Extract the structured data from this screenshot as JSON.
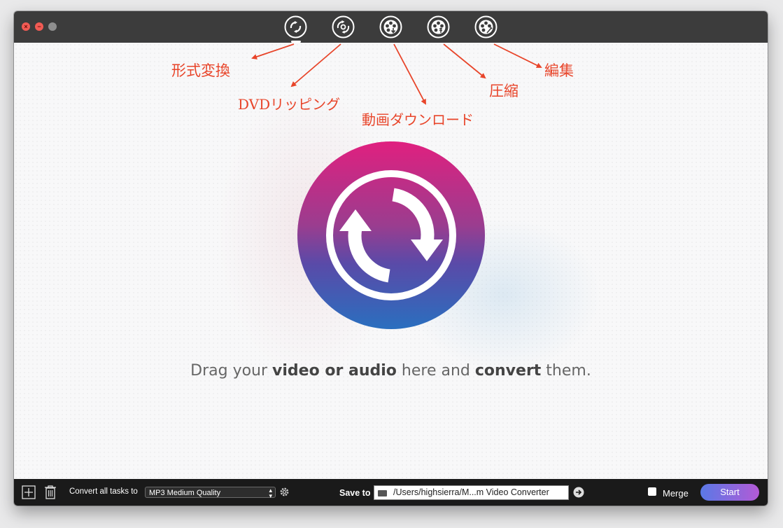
{
  "toolbar": {
    "items": [
      {
        "name": "convert",
        "annotation": "形式変換"
      },
      {
        "name": "dvd-ripping",
        "annotation": "DVDリッピング"
      },
      {
        "name": "video-download",
        "annotation": "動画ダウンロード"
      },
      {
        "name": "compress",
        "annotation": "圧縮"
      },
      {
        "name": "edit",
        "annotation": "編集"
      }
    ]
  },
  "main": {
    "drag_prefix": "Drag your ",
    "drag_bold1": "video or audio",
    "drag_middle": " here and ",
    "drag_bold2": "convert",
    "drag_suffix": " them."
  },
  "bottom": {
    "convert_label": "Convert all tasks to",
    "format_value": "MP3 Medium Quality",
    "save_label": "Save to",
    "save_path": "/Users/highsierra/M...m Video Converter",
    "merge_label": "Merge",
    "start_label": "Start"
  },
  "colors": {
    "annotation": "#e8452a",
    "titlebar": "#3c3c3c",
    "start_gradient_from": "#5a79e6",
    "start_gradient_to": "#b35ad6"
  }
}
